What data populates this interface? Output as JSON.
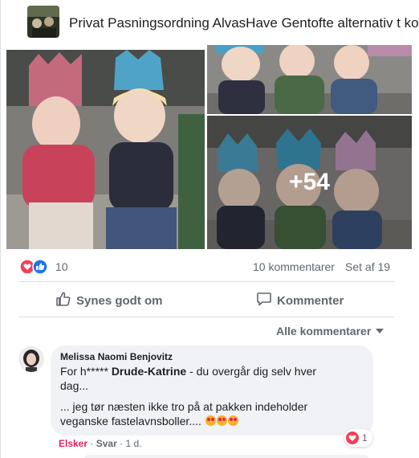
{
  "post": {
    "group_title": "Privat Pasningsordning AlvasHave Gentofte alternativ t ko",
    "more_photos": "+54"
  },
  "stats": {
    "reactions_count": "10",
    "comments_count": "10 kommentarer",
    "seen_count": "Set af 19",
    "reaction_icons": [
      "heart-icon",
      "like-icon"
    ]
  },
  "actions": {
    "like_label": "Synes godt om",
    "comment_label": "Kommenter"
  },
  "comments_sort": {
    "label": "Alle kommentarer"
  },
  "comment": {
    "author": "Melissa Naomi Benjovitz",
    "text_prefix": "For h*****",
    "mention": "Drude-Katrine",
    "text_suffix": "- du overgår dig selv hver",
    "line2": "dag...",
    "line3": "... jeg tør næsten ikke tro på at pakken indeholder",
    "line4": "veganske fastelavnsboller....",
    "meta_love": "Elsker",
    "meta_reply": "Svar",
    "meta_time": "1 d.",
    "reaction_count": "1"
  },
  "colors": {
    "like_blue": "#1877f2",
    "love_red": "#f33e58",
    "secondary_text": "#606770",
    "bubble_bg": "#f0f2f5"
  }
}
